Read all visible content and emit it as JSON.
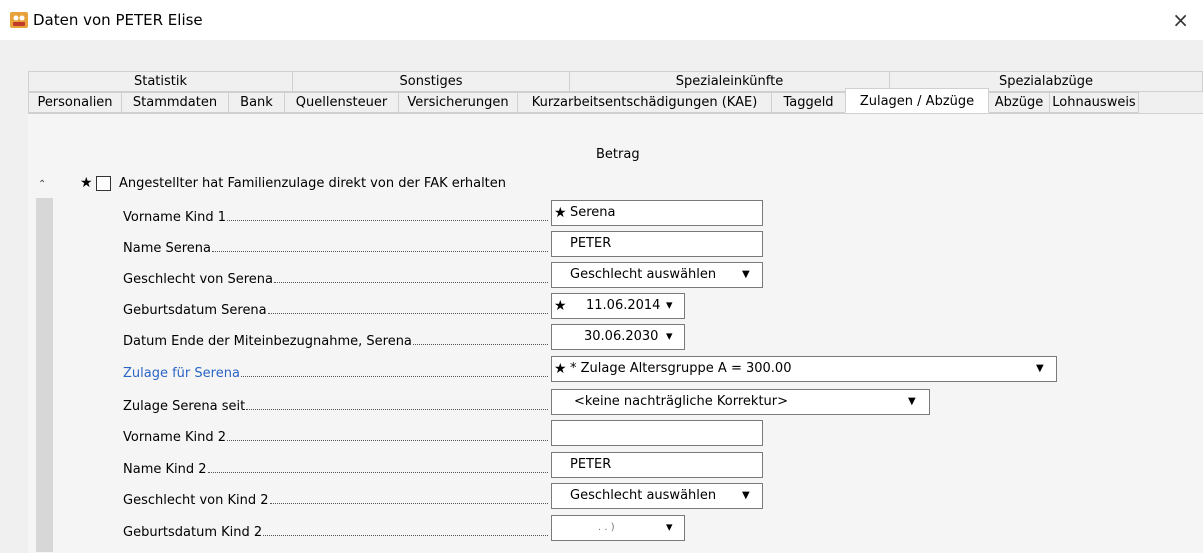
{
  "window": {
    "title": "Daten von PETER Elise",
    "close_glyph": "×"
  },
  "tabs_row1": [
    "Statistik",
    "Sonstiges",
    "Spezialeinkünfte",
    "Spezialabzüge"
  ],
  "tabs_row2": [
    "Personalien",
    "Stammdaten",
    "Bank",
    "Quellensteuer",
    "Versicherungen",
    "Kurzarbeitsentschädigungen (KAE)",
    "Taggeld",
    "Zulagen / Abzüge",
    "Abzüge",
    "Lohnausweis"
  ],
  "active_tab": "Zulagen / Abzüge",
  "column_header": "Betrag",
  "main_row": {
    "star": "★",
    "label": "Angestellter hat Familienzulage direkt von der FAK erhalten",
    "checked": false
  },
  "fields": {
    "vorname_kind1": {
      "label": "Vorname Kind 1",
      "value": "Serena",
      "star": "★"
    },
    "name_kind1": {
      "label": "Name Serena",
      "value": "PETER"
    },
    "geschlecht_kind1": {
      "label": "Geschlecht von Serena",
      "value": "Geschlecht auswählen",
      "arrow": "▼"
    },
    "geburtsdatum_kind1": {
      "label": "Geburtsdatum Serena",
      "value": "11.06.2014",
      "star": "★",
      "arrow": "▾"
    },
    "datum_ende": {
      "label": "Datum Ende der Miteinbezugnahme, Serena",
      "value": "30.06.2030",
      "arrow": "▾"
    },
    "zulage_kind1": {
      "label": "Zulage für Serena",
      "value": "* Zulage Altersgruppe A = 300.00",
      "star": "★",
      "arrow": "▼"
    },
    "zulage_seit": {
      "label": "Zulage Serena seit",
      "value": "<keine nachträgliche Korrektur>",
      "arrow": "▼"
    },
    "vorname_kind2": {
      "label": "Vorname Kind 2",
      "value": ""
    },
    "name_kind2": {
      "label": "Name Kind 2",
      "value": "PETER"
    },
    "geschlecht_kind2": {
      "label": "Geschlecht von Kind 2",
      "value": "Geschlecht auswählen",
      "arrow": "▼"
    },
    "geburtsdatum_kind2": {
      "label": "Geburtsdatum Kind 2",
      "value": ".   .     )",
      "arrow": "▾"
    }
  },
  "colors": {
    "link_label": "#2b65c4",
    "window_bg": "#f0f0f0"
  }
}
